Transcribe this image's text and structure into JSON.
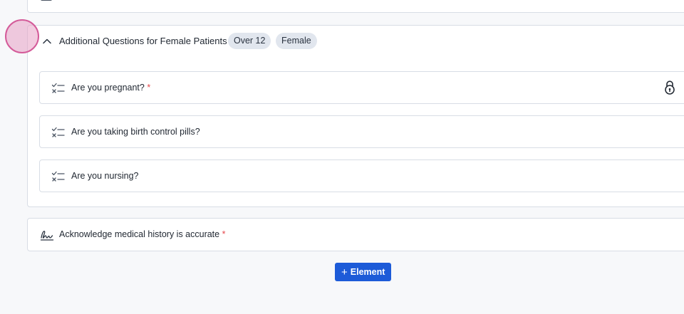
{
  "colors": {
    "accent": "#1d5bd8",
    "required": "#e5484d",
    "chip_bg": "#e1e6ee",
    "cursor": "#d45b99"
  },
  "section_group": {
    "title": "Additional Questions for Female Patients",
    "expanded": true,
    "chips": [
      "Over 12",
      "Female"
    ],
    "questions": [
      {
        "label": "Are you pregnant?",
        "required_mark": "*",
        "icon": "checklist-icon",
        "locked": true
      },
      {
        "label": "Are you taking birth control pills?",
        "icon": "checklist-icon"
      },
      {
        "label": "Are you nursing?",
        "icon": "checklist-icon"
      }
    ]
  },
  "acknowledge": {
    "label": "Acknowledge medical history is accurate",
    "required_mark": "*",
    "icon": "signature-icon"
  },
  "add_element_button": {
    "plus": "+",
    "label": "Element"
  }
}
